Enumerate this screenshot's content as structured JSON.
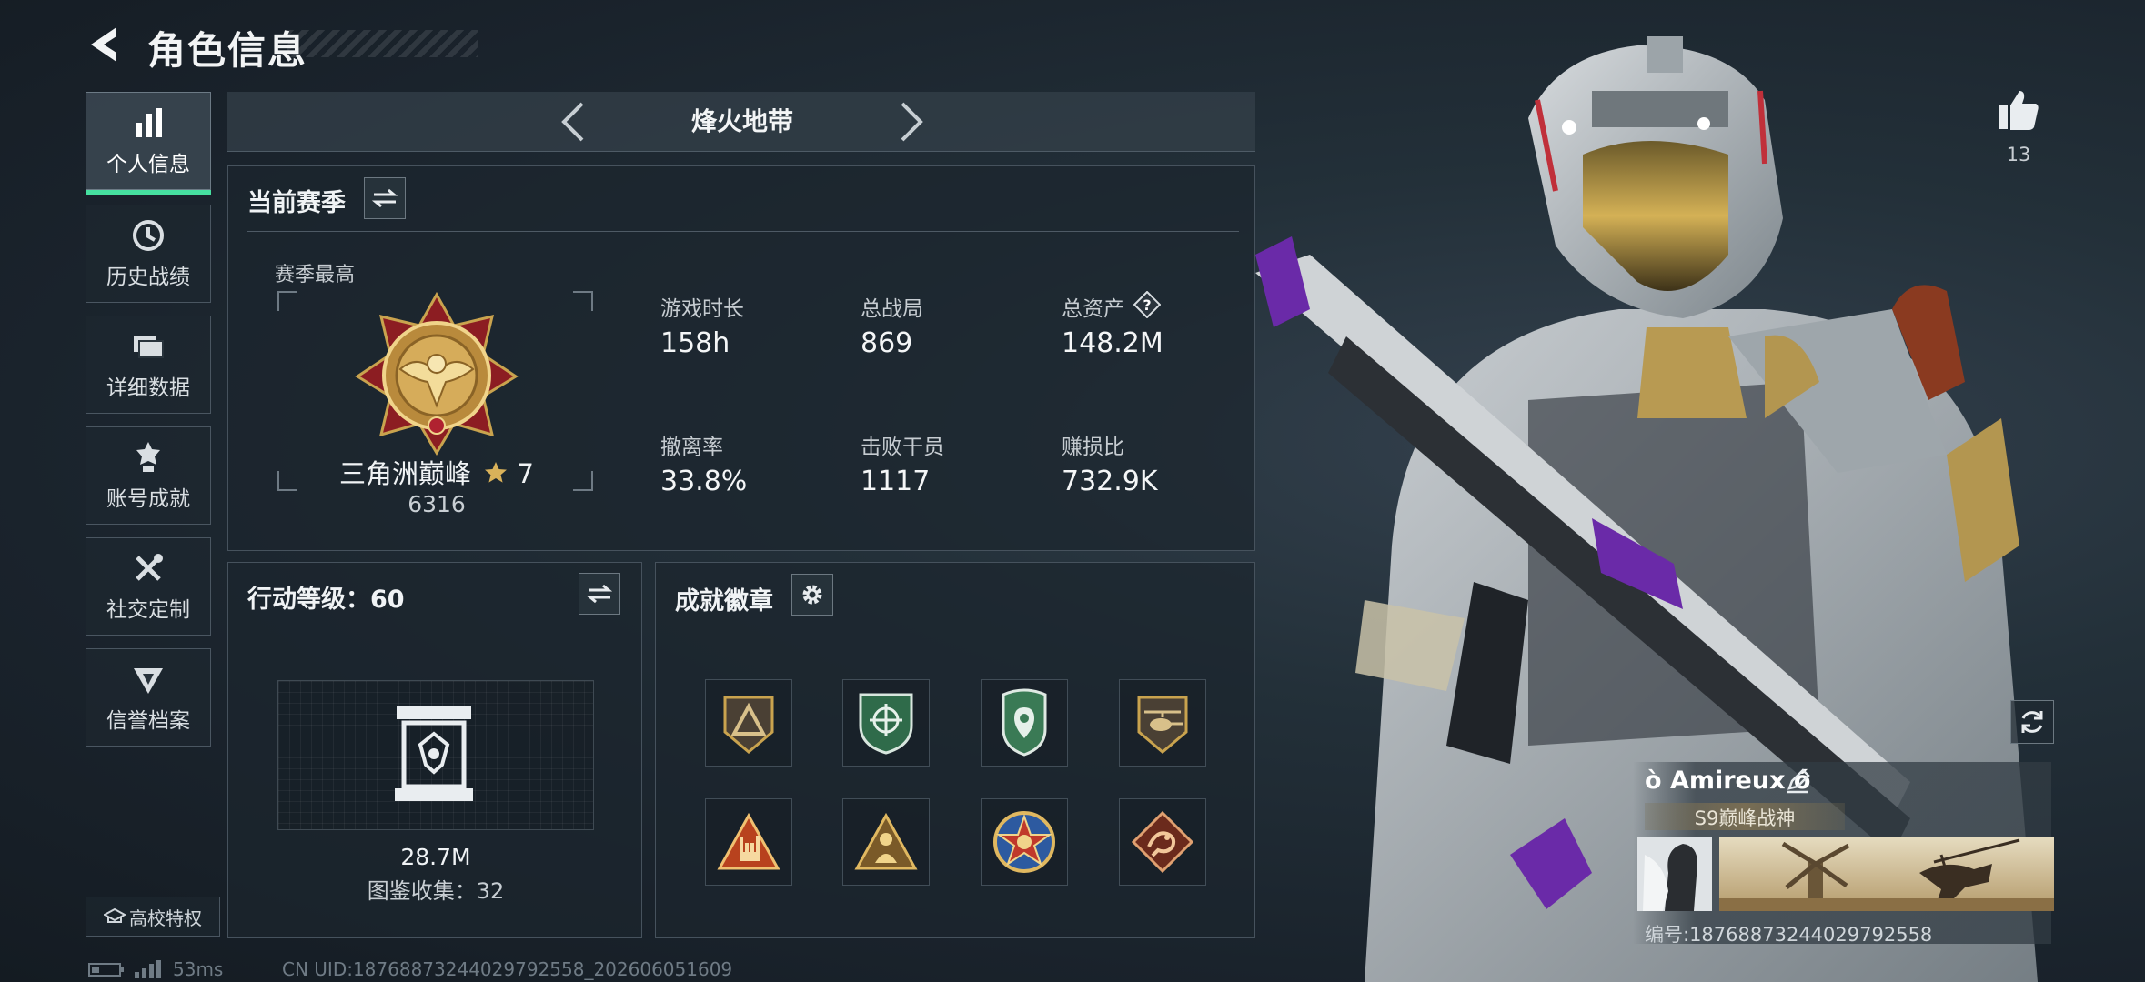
{
  "header": {
    "title": "角色信息"
  },
  "sidebar": {
    "items": [
      {
        "label": "个人信息",
        "active": true,
        "icon": "bar-chart-icon"
      },
      {
        "label": "历史战绩",
        "active": false,
        "icon": "clock-icon"
      },
      {
        "label": "详细数据",
        "active": false,
        "icon": "folders-icon"
      },
      {
        "label": "账号成就",
        "active": false,
        "icon": "achievement-icon"
      },
      {
        "label": "社交定制",
        "active": false,
        "icon": "tools-icon"
      },
      {
        "label": "信誉档案",
        "active": false,
        "icon": "reputation-icon"
      }
    ],
    "campus_label": "高校特权"
  },
  "mode": {
    "name": "烽火地带"
  },
  "season": {
    "title": "当前赛季",
    "best_label": "赛季最高",
    "rank_name": "三角洲巅峰",
    "rank_star": "7",
    "rank_score": "6316",
    "stats": [
      {
        "label": "游戏时长",
        "value": "158h"
      },
      {
        "label": "总战局",
        "value": "869"
      },
      {
        "label": "总资产",
        "value": "148.2M"
      },
      {
        "label": "撤离率",
        "value": "33.8%"
      },
      {
        "label": "击败干员",
        "value": "1117"
      },
      {
        "label": "赚损比",
        "value": "732.9K"
      }
    ]
  },
  "level": {
    "title": "行动等级：60",
    "collection_value": "28.7M",
    "collection_label": "图鉴收集：32"
  },
  "badges": {
    "title": "成就徽章",
    "items": [
      "triangle-emblem-icon",
      "shield-crosshair-icon",
      "shield-pin-icon",
      "helicopter-icon",
      "rock-hand-icon",
      "triangle-figure-icon",
      "star-medal-icon",
      "dragon-icon"
    ]
  },
  "profile": {
    "likes": "13",
    "player_name": "ò Amireux ó",
    "player_title": "S9巅峰战神",
    "card_id": "编号:18768873244029792558"
  },
  "status": {
    "ping": "53ms",
    "uid": "CN UID:18768873244029792558_202606051609"
  },
  "colors": {
    "accent": "#46e0a0",
    "gold": "#c9a34e"
  }
}
